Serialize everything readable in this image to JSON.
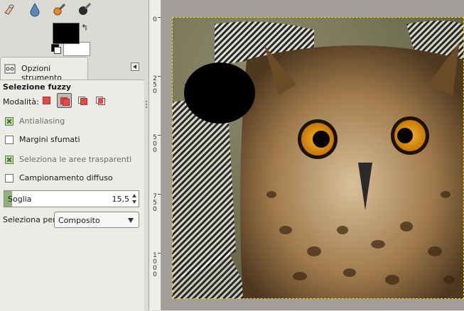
{
  "toolbox": {
    "tools": [
      {
        "icon": "smudge-finger-icon"
      },
      {
        "icon": "blur-drop-icon"
      },
      {
        "icon": "dodge-burn-icon"
      },
      {
        "icon": "ink-pen-icon"
      }
    ],
    "colors": {
      "foreground": "#000000",
      "background": "#ffffff"
    }
  },
  "tool_options": {
    "tab_label": "Opzioni strumento",
    "title": "Selezione fuzzy",
    "mode_label": "Modalità:",
    "modes": [
      "replace",
      "add",
      "subtract",
      "intersect"
    ],
    "active_mode": "add",
    "options": [
      {
        "label": "Antialiasing",
        "checked": true,
        "dim": true
      },
      {
        "label": "Margini sfumati",
        "checked": false,
        "dim": false
      },
      {
        "label": "Seleziona le aree trasparenti",
        "checked": true,
        "dim": true
      },
      {
        "label": "Campionamento diffuso",
        "checked": false,
        "dim": false
      }
    ],
    "threshold": {
      "label": "Soglia",
      "value": "15,5",
      "fill_fraction": 0.06
    },
    "select_by_label": "Seleziona per:",
    "select_by_value": "Composito"
  },
  "ruler": {
    "ticks": [
      {
        "digits": "0"
      },
      {
        "digits": "250"
      },
      {
        "digits": "500"
      },
      {
        "digits": "750"
      },
      {
        "digits": "1000"
      }
    ]
  },
  "accent": {
    "selection": "#f0d800",
    "toggle_on": "#b9d3a6"
  }
}
